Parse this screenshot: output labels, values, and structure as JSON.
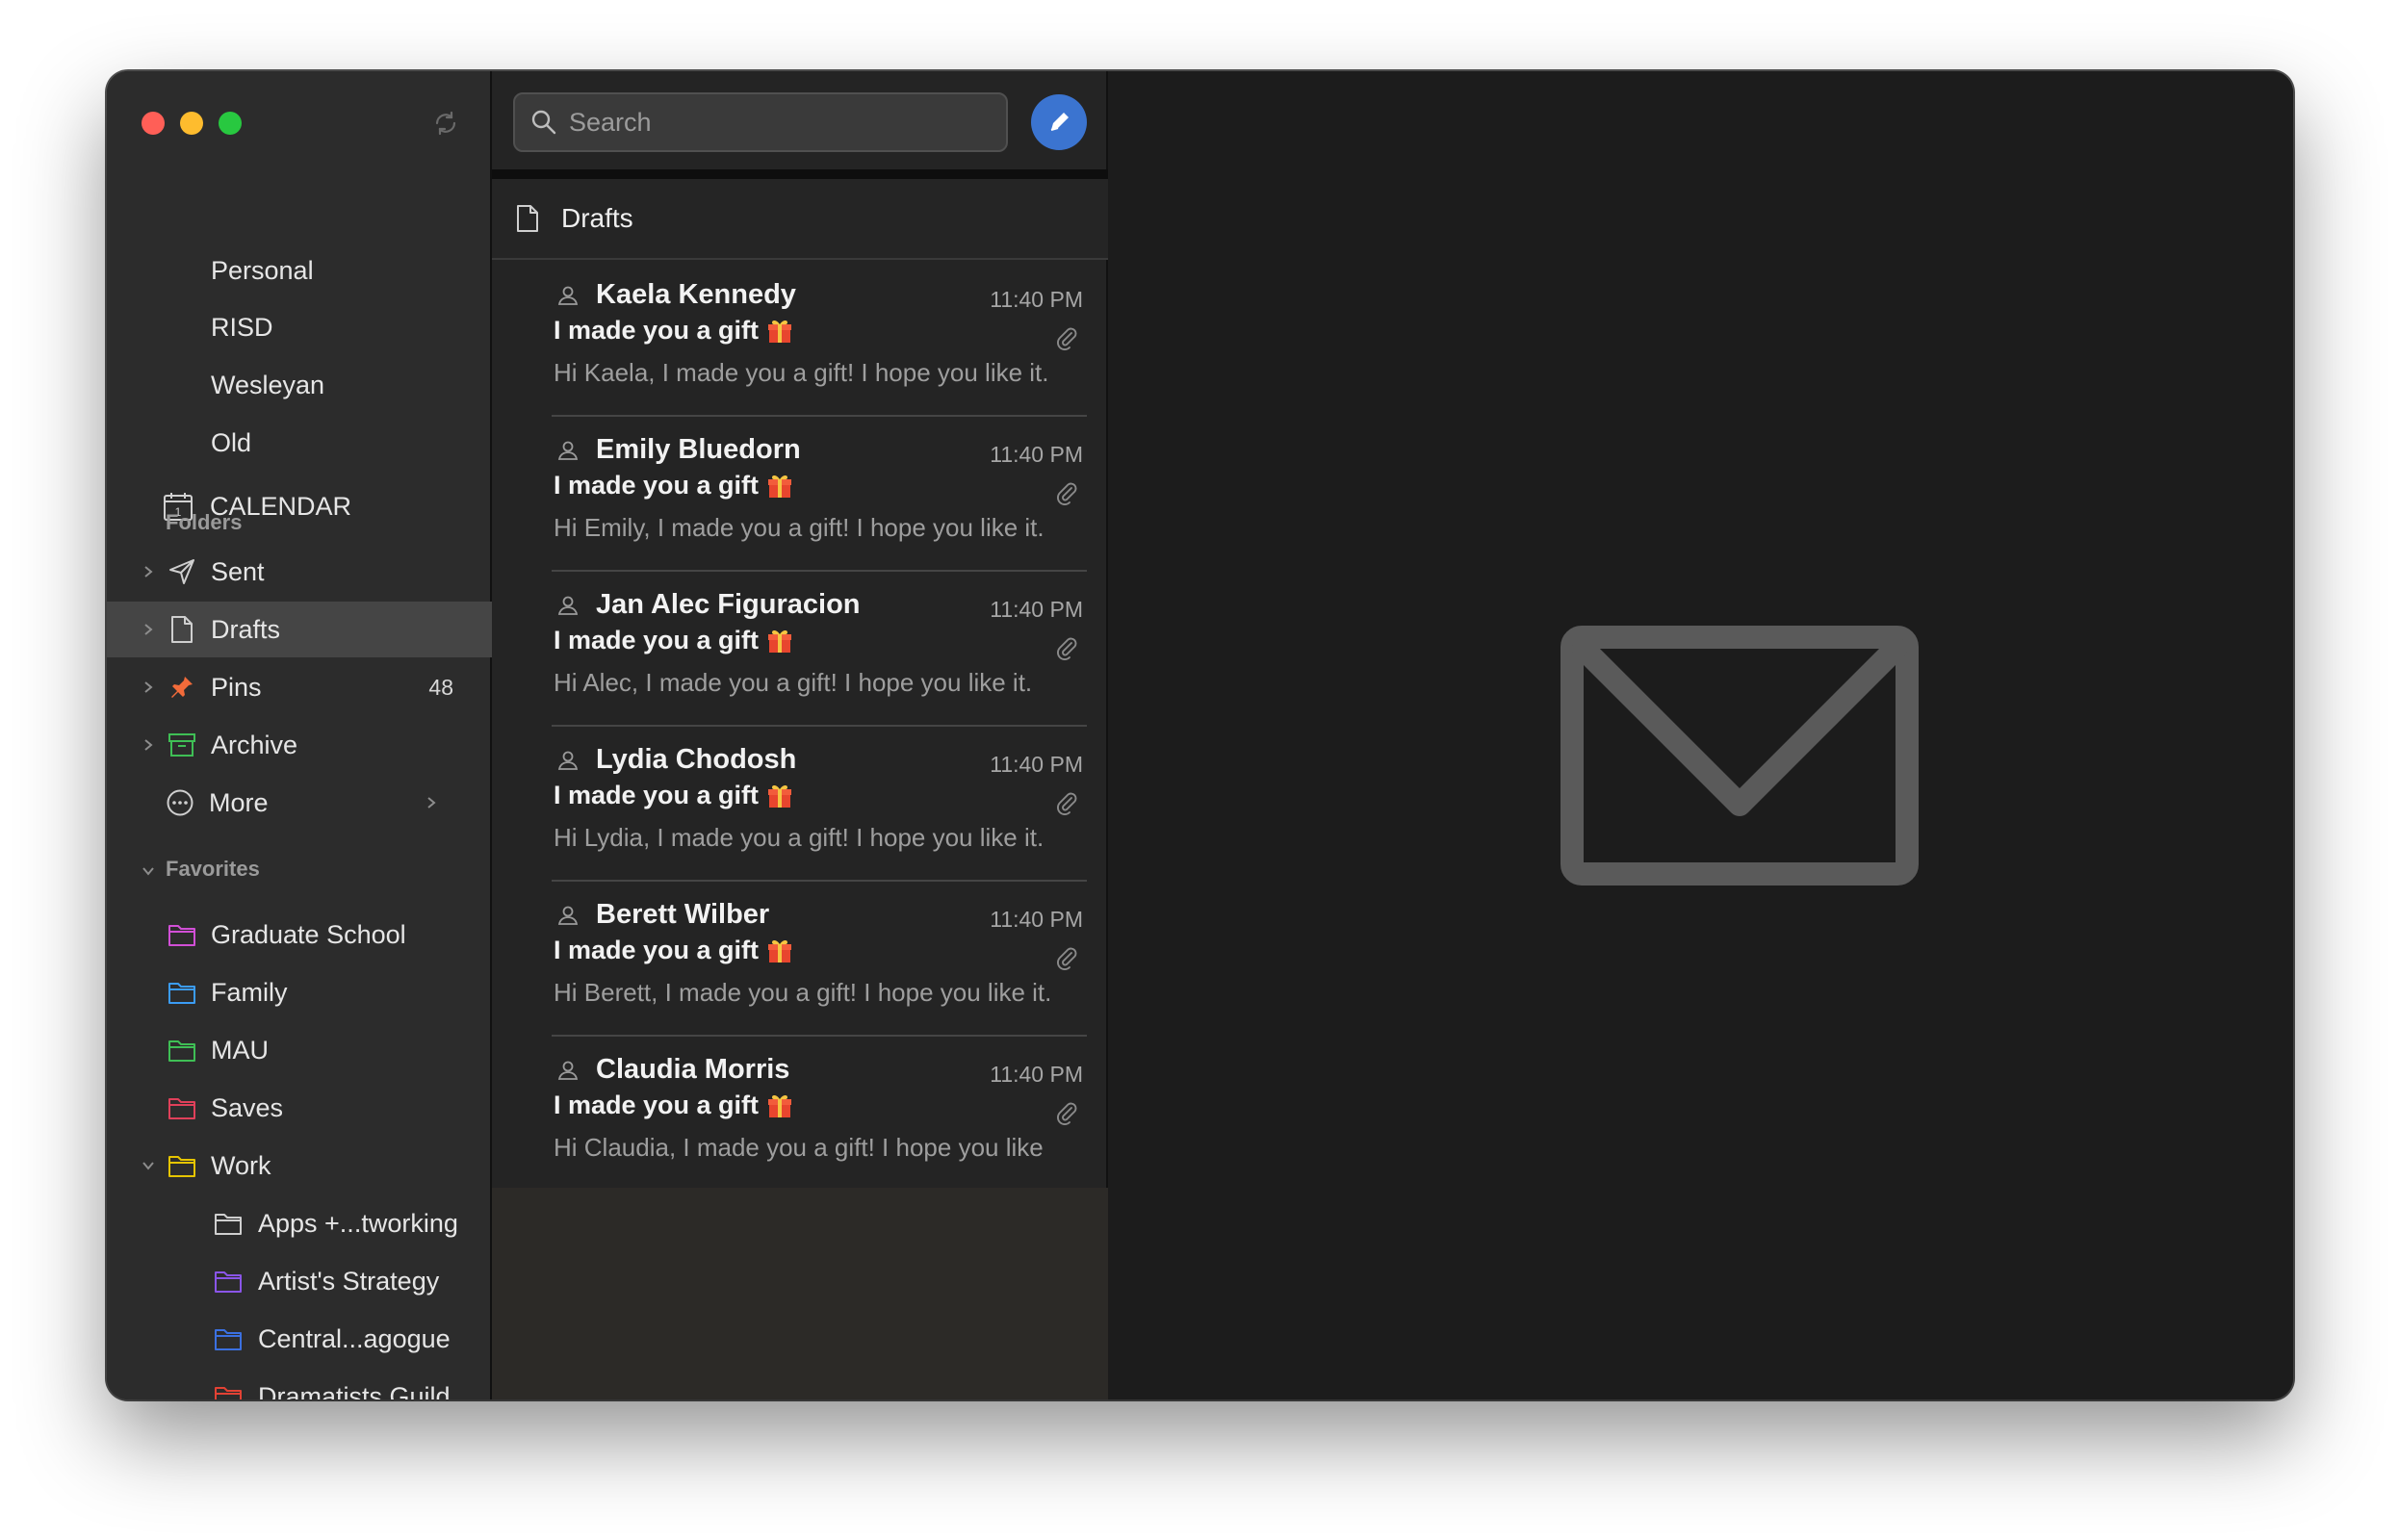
{
  "sidebar": {
    "accounts": [
      "Personal",
      "RISD",
      "Wesleyan",
      "Old"
    ],
    "calendar_label": "CALENDAR",
    "calendar_day": "1",
    "folders_header": "Folders",
    "folders": [
      {
        "label": "Sent",
        "icon": "paper-plane-icon"
      },
      {
        "label": "Drafts",
        "icon": "document-icon",
        "selected": true
      },
      {
        "label": "Pins",
        "icon": "pin-icon",
        "count": "48",
        "color": "#f26b3a"
      },
      {
        "label": "Archive",
        "icon": "archive-box-icon",
        "color": "#3fbf55"
      },
      {
        "label": "More",
        "icon": "ellipsis-circle-icon"
      }
    ],
    "favorites_header": "Favorites",
    "favorites": [
      {
        "label": "Graduate School",
        "color": "#d14fd6"
      },
      {
        "label": "Family",
        "color": "#3b9cf5"
      },
      {
        "label": "MAU",
        "color": "#3fbf55"
      },
      {
        "label": "Saves",
        "color": "#e0405a"
      },
      {
        "label": "Work",
        "color": "#e5c400"
      },
      {
        "label": "Apps +...tworking",
        "color": "#cfcfcf"
      },
      {
        "label": "Artist's Strategy",
        "color": "#8a55e8"
      },
      {
        "label": "Central...agogue",
        "color": "#3b70e0"
      },
      {
        "label": "Dramatists Guild",
        "color": "#e34234"
      }
    ]
  },
  "search": {
    "placeholder": "Search"
  },
  "list": {
    "title": "Drafts",
    "messages": [
      {
        "name": "Kaela Kennedy",
        "time": "11:40 PM",
        "subject": "I made you a gift",
        "preview": "Hi Kaela, I made you a gift! I hope you like it."
      },
      {
        "name": "Emily Bluedorn",
        "time": "11:40 PM",
        "subject": "I made you a gift",
        "preview": "Hi Emily, I made you a gift! I hope you like it."
      },
      {
        "name": "Jan Alec Figuracion",
        "time": "11:40 PM",
        "subject": "I made you a gift",
        "preview": "Hi Alec, I made you a gift! I hope you like it."
      },
      {
        "name": "Lydia Chodosh",
        "time": "11:40 PM",
        "subject": "I made you a gift",
        "preview": "Hi Lydia, I made you a gift! I hope you like it."
      },
      {
        "name": "Berett Wilber",
        "time": "11:40 PM",
        "subject": "I made you a gift",
        "preview": "Hi Berett, I made you a gift! I hope you like it."
      },
      {
        "name": "Claudia Morris",
        "time": "11:40 PM",
        "subject": "I made you a gift",
        "preview": "Hi Claudia, I made you a gift! I hope you like"
      }
    ]
  },
  "colors": {
    "accent": "#3b74d0",
    "selected_row": "#454545"
  }
}
